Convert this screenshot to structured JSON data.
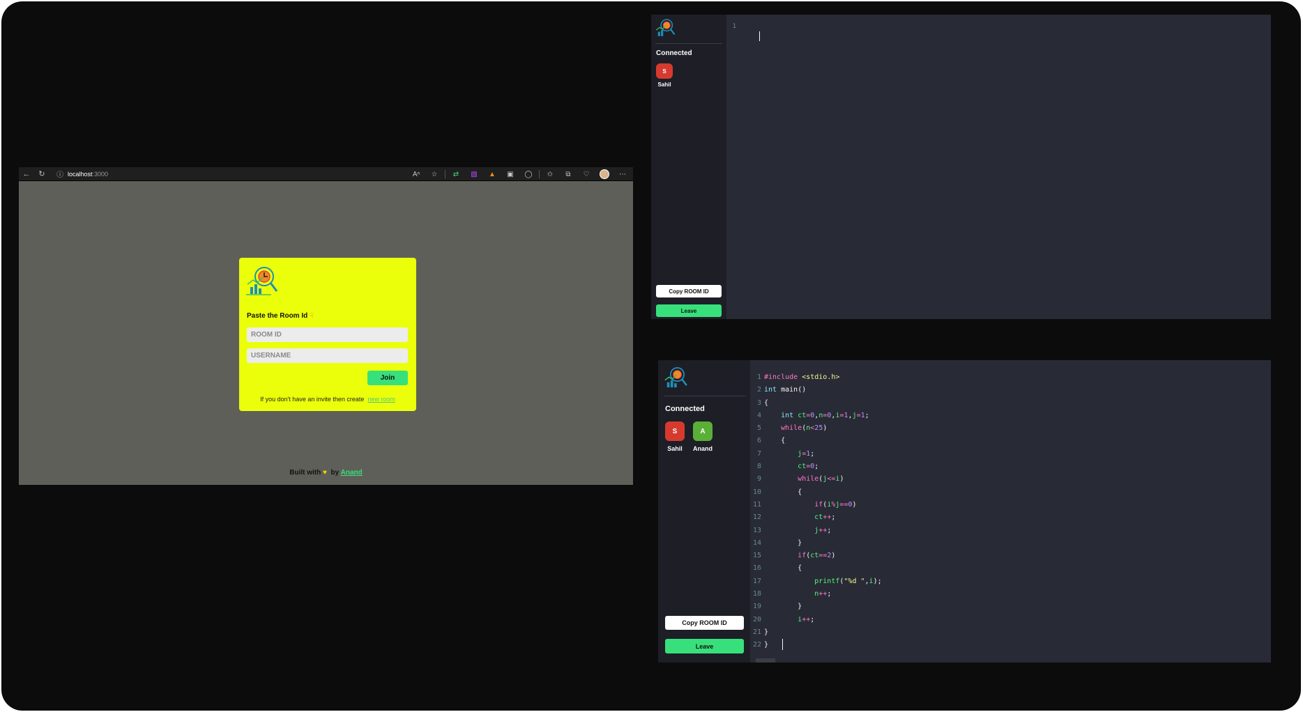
{
  "browser": {
    "address_host": "localhost",
    "address_port": ":3000",
    "login_card": {
      "heading": "Paste the Room Id",
      "room_id_placeholder": "ROOM ID",
      "username_placeholder": "USERNAME",
      "join_label": "Join",
      "invite_text": "If you don't have an invite then create",
      "invite_link": "new room"
    },
    "footer": {
      "built_with": "Built with",
      "by": "by",
      "author": "Anand"
    }
  },
  "editor_top": {
    "connected_label": "Connected",
    "clients": [
      {
        "initial": "S",
        "name": "Sahil",
        "color": "#d63a2f"
      }
    ],
    "copy_label": "Copy ROOM ID",
    "leave_label": "Leave",
    "line_numbers": [
      "1"
    ]
  },
  "editor_bottom": {
    "connected_label": "Connected",
    "clients": [
      {
        "initial": "S",
        "name": "Sahil",
        "color": "#d63a2f"
      },
      {
        "initial": "A",
        "name": "Anand",
        "color": "#5ab036"
      }
    ],
    "copy_label": "Copy ROOM ID",
    "leave_label": "Leave",
    "line_numbers": [
      "1",
      "2",
      "3",
      "4",
      "5",
      "6",
      "7",
      "8",
      "9",
      "10",
      "11",
      "12",
      "13",
      "14",
      "15",
      "16",
      "17",
      "18",
      "19",
      "20",
      "21",
      "22"
    ],
    "code_lines": [
      "#include <stdio.h>",
      "int main()",
      "{",
      "    int ct=0,n=0,i=1,j=1;",
      "    while(n<25)",
      "    {",
      "        j=1;",
      "        ct=0;",
      "        while(j<=i)",
      "        {",
      "            if(i%j==0)",
      "            ct++;",
      "            j++;",
      "        }",
      "        if(ct==2)",
      "        {",
      "            printf(\"%d \",i);",
      "            n++;",
      "        }",
      "        i++;",
      "}",
      "} "
    ]
  },
  "colors": {
    "frame": "#0c0c0c",
    "browser_page": "#5f5f59",
    "card": "#ebff0b",
    "accent_green": "#38e07b",
    "editor_bg": "#282a36",
    "sidebar_bg": "#1d1e26"
  }
}
